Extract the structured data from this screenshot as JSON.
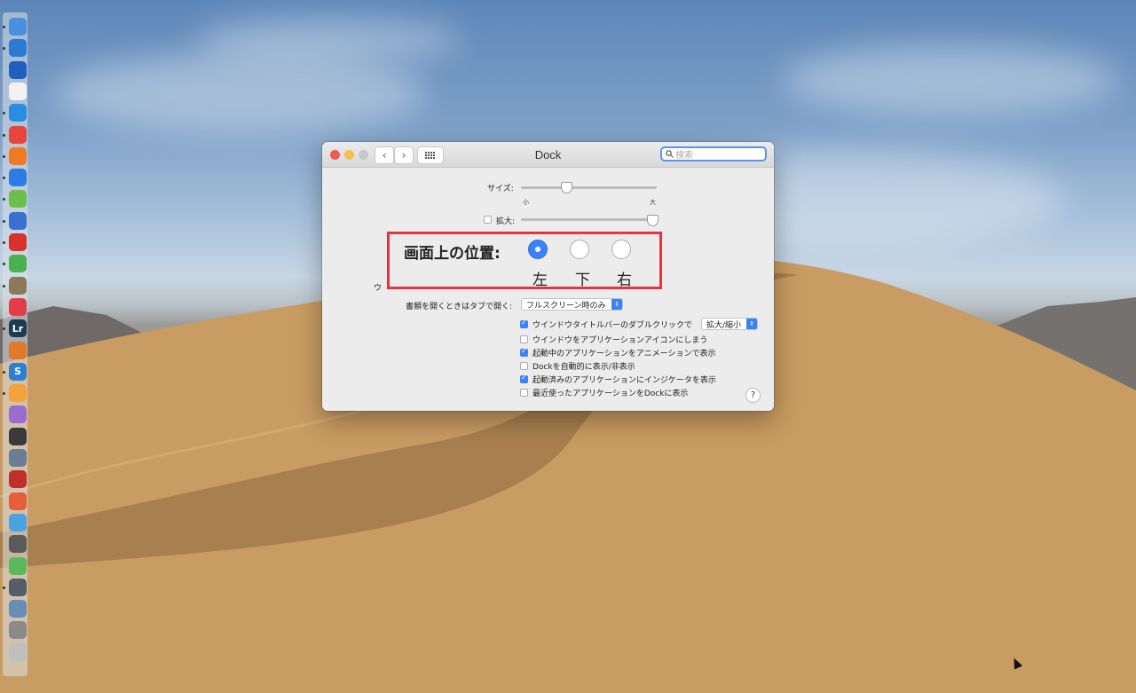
{
  "window": {
    "title": "Dock",
    "search_placeholder": "検索",
    "nav_back": "‹",
    "nav_forward": "›",
    "grid_icon": "grid-icon"
  },
  "size": {
    "label": "サイズ:",
    "min_label": "小",
    "max_label": "大",
    "value": 0.33
  },
  "magnification": {
    "label": "拡大:",
    "checked": false,
    "value": 1.0
  },
  "position": {
    "label": "画面上の位置:",
    "options": [
      {
        "label": "左",
        "selected": true
      },
      {
        "label": "下",
        "selected": false
      },
      {
        "label": "右",
        "selected": false
      }
    ],
    "highlight_color": "#e2363f"
  },
  "minimize_row": {
    "label_partial": "ウ"
  },
  "open_docs": {
    "label": "書類を開くときはタブで開く:",
    "value": "フルスクリーン時のみ"
  },
  "double_click": {
    "label": "ウインドウタイトルバーのダブルクリックで",
    "checked": true,
    "value": "拡大/縮小"
  },
  "options": [
    {
      "label": "ウインドウをアプリケーションアイコンにしまう",
      "checked": false
    },
    {
      "label": "起動中のアプリケーションをアニメーションで表示",
      "checked": true
    },
    {
      "label": "Dockを自動的に表示/非表示",
      "checked": false
    },
    {
      "label": "起動済みのアプリケーションにインジケータを表示",
      "checked": true
    },
    {
      "label": "最近使ったアプリケーションをDockに表示",
      "checked": false
    }
  ],
  "help_label": "?",
  "colors": {
    "accent": "#3a82f7",
    "close": "#ee5c54",
    "minimize": "#f5bf4f",
    "zoom": "#c8c8c8"
  },
  "dock_icons": [
    "finder-icon",
    "tweetbot-icon",
    "omnifocus-icon",
    "cow-icon",
    "safari-icon",
    "chrome-icon",
    "firefox-icon",
    "navigation-icon",
    "notes-icon",
    "compass-icon",
    "pdf-icon",
    "evernote-icon",
    "box-icon",
    "pocket-icon",
    "lightroom-icon",
    "rocket-icon",
    "scrivener-icon",
    "pages-icon",
    "pencil-icon",
    "audio-icon",
    "download-icon",
    "phone-icon",
    "photo-icon",
    "globe-icon",
    "movie-icon",
    "leaf-icon",
    "system-preferences-icon",
    "preview-icon",
    "archive-icon",
    "trash-icon"
  ]
}
